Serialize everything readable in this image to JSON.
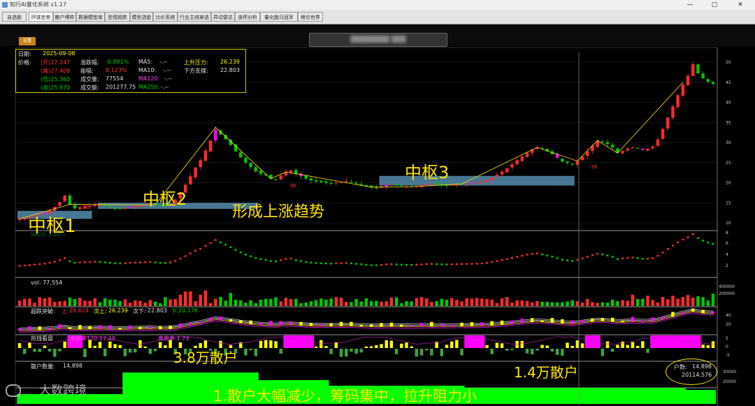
{
  "window": {
    "title": "知行AI量化系统 v1.17",
    "minimize_glyph": "—",
    "maximize_glyph": "▢",
    "close_glyph": "✕"
  },
  "tabs": [
    {
      "label": "自选股",
      "active": false
    },
    {
      "label": "环球走势",
      "active": true
    },
    {
      "label": "散户博弈",
      "active": false
    },
    {
      "label": "数据模型库",
      "active": false
    },
    {
      "label": "恐慌超跌",
      "active": false
    },
    {
      "label": "模型选股",
      "active": false
    },
    {
      "label": "比价系统",
      "active": false
    },
    {
      "label": "行业主线穿透",
      "active": false
    },
    {
      "label": "异动雷达",
      "active": false
    },
    {
      "label": "涨停分析",
      "active": false
    },
    {
      "label": "量化跑马冠军",
      "active": false
    },
    {
      "label": "继论世界",
      "active": false
    }
  ],
  "toolbar": {
    "settings_label": "设置",
    "stock_title": "████████ ███"
  },
  "info_panel": {
    "date_label": "日期:",
    "date_value": "2025-09-08",
    "price_label": "价格:",
    "open": "(开)27.247",
    "high": "(高)27.408",
    "low": "(低)25.360",
    "close": "(收)25.870",
    "change_pct_label": "涨跌幅:",
    "change_pct_value": "-0.881%",
    "amplitude_label": "振幅:",
    "amplitude_value": "8.123%",
    "volume_label": "成交量:",
    "volume_value": "77554",
    "amount_label": "成交额:",
    "amount_value": "201277.75",
    "ma5_label": "MA5:",
    "ma5_value": "-.--",
    "ma10_label": "MA10:",
    "ma10_value": "-.--",
    "ma120_label": "MA120:",
    "ma120_value": "-.--",
    "ma250_label": "MA250:",
    "ma250_value": "-.--",
    "resistance_label": "上升压力:",
    "resistance_value": "26.239",
    "support_label": "下方支撑:",
    "support_value": "22.803"
  },
  "axes": {
    "price_ticks": [
      "50",
      "45",
      "40",
      "35",
      "30",
      "25",
      "20",
      "15",
      "10"
    ],
    "osc_ticks": [
      "8",
      "6",
      "4",
      "2"
    ],
    "vol_ticks": [
      "400000",
      "200000"
    ],
    "breakout_ticks": [
      "40",
      "20"
    ],
    "hot_ticks": [
      "5",
      "0",
      "-5"
    ],
    "holder_ticks": [
      "30000",
      "20000"
    ]
  },
  "panels": {
    "osc_label": "MACD: 2.00(-)",
    "vol_label": "vol: 77,554",
    "breakout_title": "超跌突破:",
    "breakout_up_label": "上:",
    "breakout_up_value": "28.624",
    "breakout_next_up_label": "次上:",
    "breakout_next_up_value": "26.239",
    "breakout_next_down_label": "次下:",
    "breakout_next_down_value": "22.803",
    "breakout_down_label": "下:",
    "breakout_down_value": "20.278",
    "hot_title": "热钱看盘",
    "hot_item1": "离离率120:17.48",
    "hot_item2": "离离率:1.73",
    "holder_title": "散户数量:",
    "holder_value": "14,898",
    "holder_box_label": "户数:",
    "holder_box_value": "14,898",
    "holder_box_value2": "20114.576"
  },
  "annotations": {
    "zone1": "中枢1",
    "zone2": "中枢2",
    "zone3": "中枢3",
    "trend": "形成上涨趋势",
    "retail_high": "3.8万散户",
    "retail_low": "1.4万散户",
    "conclusion": "1.散户大幅减少，筹码集中，拉升阻力小",
    "mark_3b_1": "3B",
    "mark_3b_2": "3B",
    "mark_3b_3": "3B"
  },
  "watermark": {
    "text": "大数跨境"
  },
  "colors": {
    "up": "#ff2a2a",
    "down": "#00c800",
    "annotation_yellow": "#ffe600",
    "zone_box": "#5f9fc6",
    "hot_magenta": "#ff00ff",
    "hot_yellow": "#ffff00",
    "holder_green": "#00ff00"
  },
  "chart_data": {
    "type": "candlestick",
    "price_range": [
      10,
      50
    ],
    "last_date": "2025-09-08",
    "close_series": [
      11.0,
      11.2,
      11.5,
      11.8,
      12.2,
      12.6,
      13.2,
      14.0,
      15.2,
      16.8,
      14.6,
      13.6,
      13.9,
      14.1,
      14.3,
      14.5,
      14.4,
      14.2,
      13.9,
      13.6,
      13.5,
      13.7,
      14.0,
      14.2,
      14.4,
      14.6,
      14.8,
      14.5,
      14.3,
      14.2,
      14.6,
      15.8,
      17.5,
      19.5,
      21.6,
      23.8,
      25.6,
      28.0,
      30.5,
      33.2,
      32.0,
      30.8,
      29.4,
      27.8,
      26.3,
      25.0,
      23.9,
      22.8,
      22.2,
      21.8,
      21.0,
      20.8,
      21.8,
      22.7,
      23.1,
      22.2,
      21.6,
      21.0,
      20.6,
      20.3,
      20.1,
      20.0,
      19.9,
      20.1,
      20.3,
      20.4,
      20.2,
      19.9,
      19.6,
      19.2,
      18.9,
      18.8,
      19.1,
      19.4,
      19.6,
      19.4,
      19.2,
      19.1,
      19.0,
      19.2,
      19.4,
      19.6,
      19.8,
      19.6,
      19.5,
      19.4,
      19.5,
      19.6,
      19.7,
      19.8,
      19.9,
      20.0,
      20.2,
      20.6,
      21.3,
      22.0,
      22.8,
      23.6,
      24.6,
      25.6,
      26.5,
      27.5,
      28.3,
      28.8,
      28.4,
      27.8,
      27.1,
      26.2,
      25.3,
      24.9,
      24.5,
      25.4,
      26.5,
      27.8,
      29.2,
      30.5,
      30.2,
      29.6,
      28.8,
      27.4,
      28.0,
      28.5,
      28.9,
      28.6,
      28.2,
      28.4,
      29.0,
      30.8,
      33.4,
      36.2,
      39.0,
      41.8,
      44.4,
      46.6,
      49.5,
      47.2,
      46.0,
      45.1,
      44.6
    ]
  }
}
